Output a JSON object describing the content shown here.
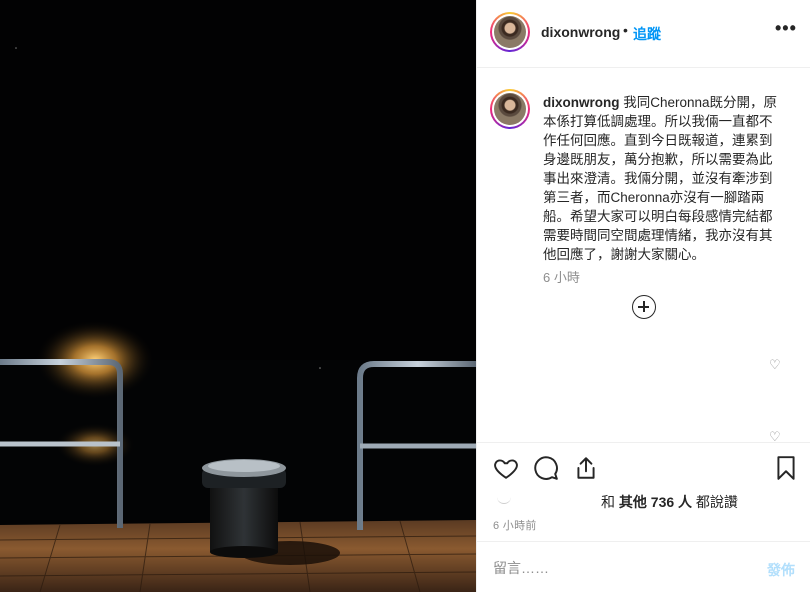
{
  "post": {
    "username": "dixonwrong",
    "separator": "•",
    "follow_label": "追蹤",
    "more_icon": "more-horizontal-icon",
    "caption_user": "dixonwrong",
    "caption_text": "我同Cheronna既分開，原本係打算低調處理。所以我倆一直都不作任何回應。直到今日既報道，連累到身邊既朋友，萬分抱歉，所以需要為此事出來澄清。我倆分開，並沒有牽涉到第三者，而Cheronna亦沒有一腳踏兩船。希望大家可以明白每段感情完結都需要時間同空間處理情緒，我亦沒有其他回應了，謝謝大家關心。",
    "caption_time": "6 小時",
    "load_more_icon": "plus-circle-icon",
    "likes_prefix": "和",
    "likes_bold": "其他 736 人",
    "likes_suffix": "都說讚",
    "post_time": "6 小時前",
    "comment_placeholder": "留言……",
    "post_button": "發佈"
  },
  "colors": {
    "accent": "#0095f6",
    "post_button_disabled": "#b2dffc",
    "secondary_text": "#8e8e8e"
  }
}
